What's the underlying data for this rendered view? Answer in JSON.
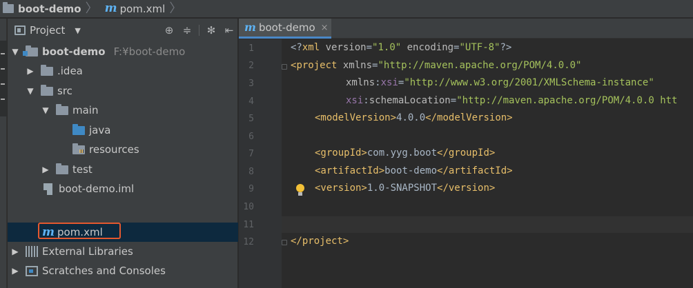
{
  "breadcrumbs": [
    {
      "icon": "folder-icon",
      "label": "boot-demo"
    },
    {
      "icon": "maven-m-icon",
      "label": "pom.xml"
    }
  ],
  "project_panel": {
    "title": "Project",
    "tool_icons": [
      "locate-icon",
      "collapse-all-icon",
      "gear-icon",
      "hide-icon"
    ],
    "tree": [
      {
        "label": "boot-demo",
        "path": "F:¥boot-demo",
        "icon": "module-folder-icon",
        "expanded": true
      },
      {
        "label": ".idea",
        "icon": "folder-icon",
        "expanded": false
      },
      {
        "label": "src",
        "icon": "folder-icon",
        "expanded": true
      },
      {
        "label": "main",
        "icon": "folder-icon",
        "expanded": true
      },
      {
        "label": "java",
        "icon": "source-folder-icon"
      },
      {
        "label": "resources",
        "icon": "resources-folder-icon"
      },
      {
        "label": "test",
        "icon": "folder-icon",
        "expanded": false
      },
      {
        "label": "boot-demo.iml",
        "icon": "iml-file-icon"
      },
      {
        "label": "pom.xml",
        "icon": "maven-m-icon",
        "selected": true
      },
      {
        "label": "External Libraries",
        "icon": "libraries-icon",
        "expanded": false
      },
      {
        "label": "Scratches and Consoles",
        "icon": "scratches-icon",
        "expanded": false
      }
    ]
  },
  "editor": {
    "tab": {
      "label": "boot-demo",
      "icon": "maven-m-icon",
      "close": "×"
    },
    "line_numbers": [
      "1",
      "2",
      "3",
      "4",
      "5",
      "6",
      "7",
      "8",
      "9",
      "10",
      "11",
      "12"
    ],
    "lines": [
      [
        "<?",
        "xml ",
        "version",
        "=",
        "\"1.0\"",
        " encoding",
        "=",
        "\"UTF-8\"",
        "?>"
      ],
      [
        "<",
        "project ",
        "xmlns",
        "=",
        "\"http://maven.apache.org/POM/4.0.0\""
      ],
      [
        "xmlns",
        ":",
        "xsi",
        "=",
        "\"http://www.w3.org/2001/XMLSchema-instance\""
      ],
      [
        "xsi",
        ":",
        "schemaLocation",
        "=",
        "\"http://maven.apache.org/POM/4.0.0 htt"
      ],
      [
        "<modelVersion>",
        "4.0.0",
        "</modelVersion>"
      ],
      [],
      [
        "<groupId>",
        "com.yyg.boot",
        "</groupId>"
      ],
      [
        "<artifactId>",
        "boot-demo",
        "</artifactId>"
      ],
      [
        "<version>",
        "1.0-SNAPSHOT",
        "</version>"
      ],
      [],
      [],
      [
        "</project>"
      ]
    ]
  },
  "colors": {
    "accent": "#4a88c7",
    "highlight_border": "#e5582e",
    "tag": "#e8bf6a",
    "string": "#a5c25c",
    "namespace": "#9876aa"
  }
}
